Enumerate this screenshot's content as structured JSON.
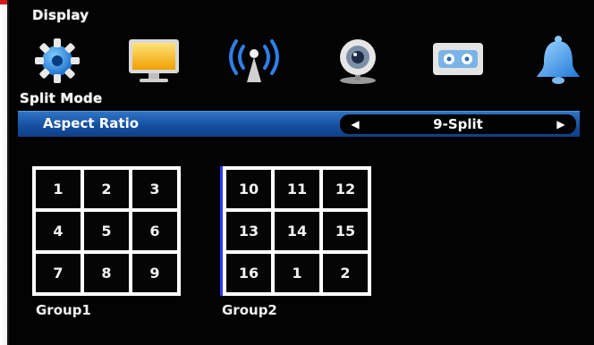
{
  "header": {
    "title": "Display"
  },
  "icons": [
    {
      "name": "gear-icon"
    },
    {
      "name": "monitor-icon"
    },
    {
      "name": "antenna-icon"
    },
    {
      "name": "webcam-icon"
    },
    {
      "name": "recorder-icon"
    },
    {
      "name": "bell-icon"
    }
  ],
  "split_mode": {
    "title": "Split Mode",
    "aspect_ratio": {
      "label": "Aspect Ratio",
      "value": "9-Split"
    }
  },
  "groups": [
    {
      "label": "Group1",
      "cells": [
        "1",
        "2",
        "3",
        "4",
        "5",
        "6",
        "7",
        "8",
        "9"
      ]
    },
    {
      "label": "Group2",
      "cells": [
        "10",
        "11",
        "12",
        "13",
        "14",
        "15",
        "16",
        "1",
        "2"
      ]
    }
  ],
  "colors": {
    "highlight_bar": "#1f5fb4",
    "background": "#030303",
    "grid_line": "#ffffff"
  }
}
